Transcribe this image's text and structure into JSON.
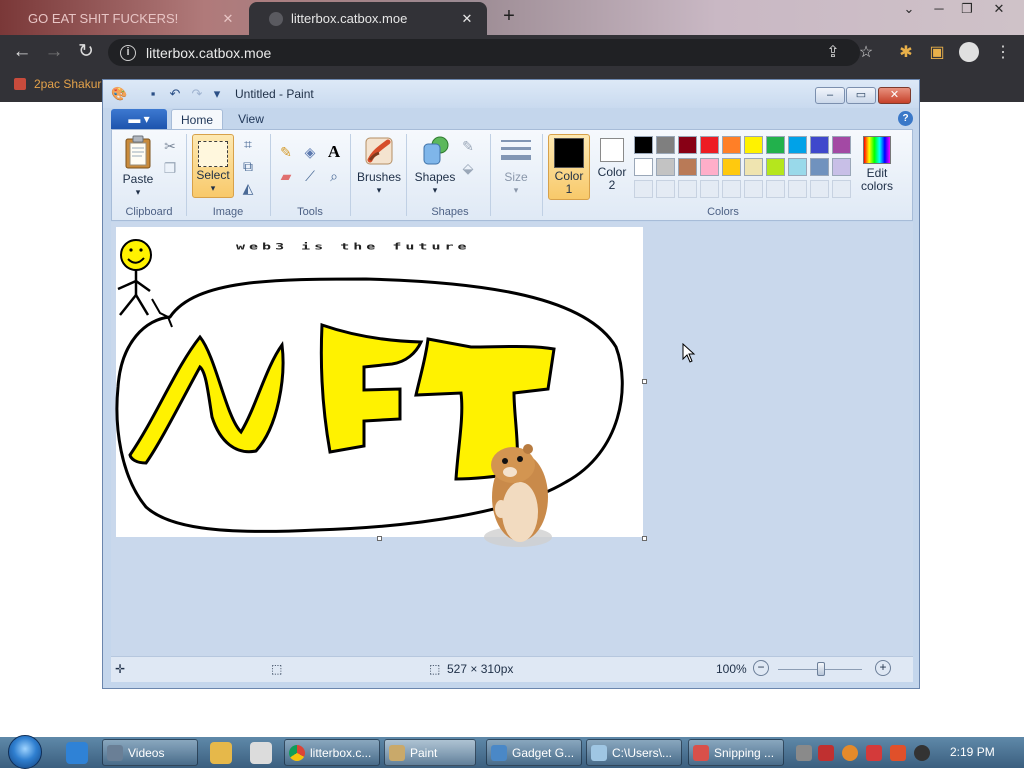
{
  "browser": {
    "tabs": [
      {
        "title": "GO EAT SHIT FUCKERS!",
        "active": false
      },
      {
        "title": "litterbox.catbox.moe",
        "active": true
      }
    ],
    "address": "litterbox.catbox.moe",
    "bookmarks": [
      {
        "label": "2pac Shakur"
      }
    ],
    "icons": [
      "back-icon",
      "forward-icon",
      "reload-icon",
      "share-icon",
      "star-icon",
      "extensions-icon",
      "sidepanel-icon",
      "profile-icon",
      "menu-icon"
    ],
    "window_controls": [
      "─",
      "❐",
      "✕"
    ]
  },
  "paint": {
    "title": "Untitled - Paint",
    "tabs": [
      "Home",
      "View"
    ],
    "groups": {
      "clipboard": "Clipboard",
      "image": "Image",
      "tools": "Tools",
      "shapes": "Shapes",
      "colors": "Colors"
    },
    "buttons": {
      "paste": "Paste",
      "select": "Select",
      "brushes": "Brushes",
      "shapes": "Shapes",
      "size": "Size",
      "color1_a": "Color",
      "color1_b": "1",
      "color2_a": "Color",
      "color2_b": "2",
      "edit_a": "Edit",
      "edit_b": "colors"
    },
    "color1": "#000000",
    "color2": "#ffffff",
    "palette_row1": [
      "#000000",
      "#7f7f7f",
      "#880015",
      "#ed1c24",
      "#ff7f27",
      "#fff200",
      "#22b14c",
      "#00a2e8",
      "#3f48cc",
      "#a349a4"
    ],
    "palette_row2": [
      "#ffffff",
      "#c3c3c3",
      "#b97a57",
      "#ffaec9",
      "#ffc90e",
      "#efe4b0",
      "#b5e61d",
      "#99d9ea",
      "#7092be",
      "#c8bfe7"
    ],
    "canvas": {
      "caption": "web3 is the future",
      "big_text": "NFT",
      "fill_color": "#fff200"
    },
    "status": {
      "dimensions": "527 × 310px",
      "zoom": "100%",
      "zoom_out": "−",
      "zoom_in": "+"
    }
  },
  "taskbar": {
    "items": [
      "Videos",
      "litterbox.c...",
      "Paint",
      "Gadget G...",
      "C:\\Users\\...",
      "Snipping ..."
    ],
    "clock": "2:19 PM"
  }
}
